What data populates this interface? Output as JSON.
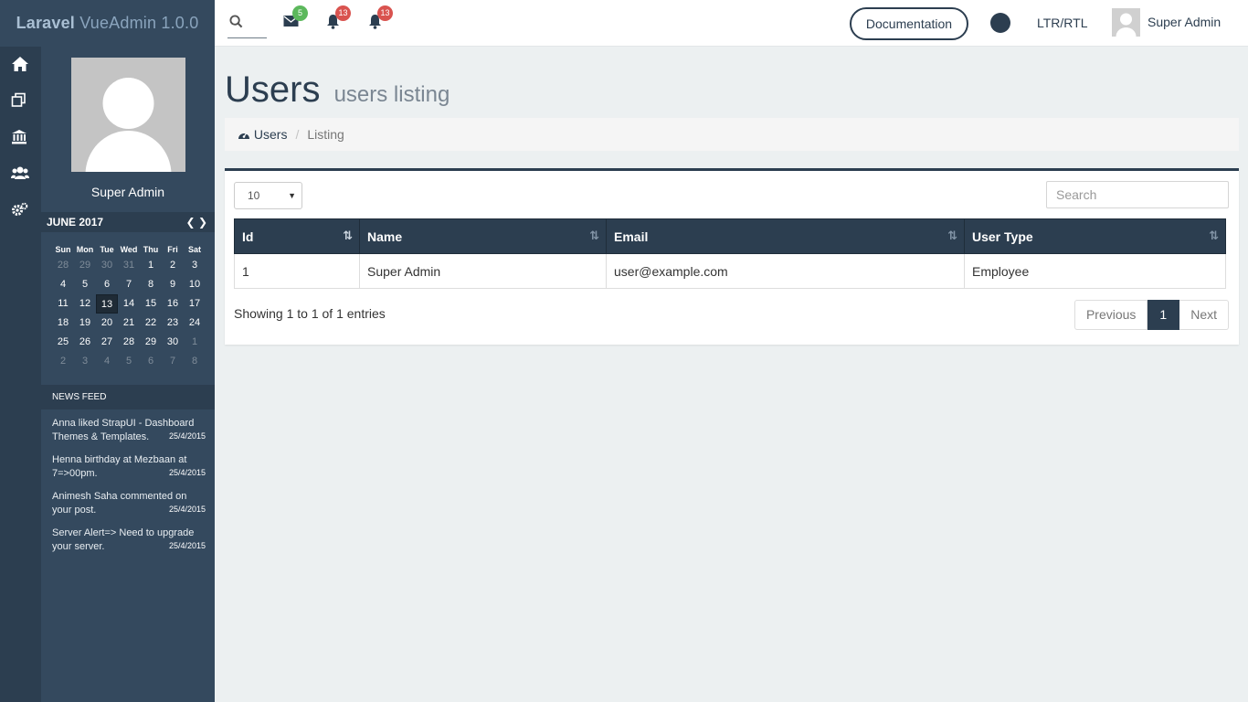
{
  "brand": {
    "bold": "Laravel",
    "rest": " VueAdmin 1.0.0"
  },
  "topbar": {
    "badges": {
      "mail": "5",
      "notifications": "13",
      "alerts": "13"
    },
    "documentation_label": "Documentation",
    "ltr_label": "LTR/RTL",
    "user_name": "Super Admin"
  },
  "sidebar": {
    "user_name": "Super Admin",
    "calendar": {
      "month_label": "JUNE 2017",
      "days_of_week": [
        "Sun",
        "Mon",
        "Tue",
        "Wed",
        "Thu",
        "Fri",
        "Sat"
      ],
      "weeks": [
        [
          "28",
          "29",
          "30",
          "31",
          "1",
          "2",
          "3"
        ],
        [
          "4",
          "5",
          "6",
          "7",
          "8",
          "9",
          "10"
        ],
        [
          "11",
          "12",
          "13",
          "14",
          "15",
          "16",
          "17"
        ],
        [
          "18",
          "19",
          "20",
          "21",
          "22",
          "23",
          "24"
        ],
        [
          "25",
          "26",
          "27",
          "28",
          "29",
          "30",
          "1"
        ],
        [
          "2",
          "3",
          "4",
          "5",
          "6",
          "7",
          "8"
        ]
      ],
      "today": "13"
    },
    "news_feed": {
      "title": "NEWS FEED",
      "items": [
        {
          "text": "Anna liked StrapUI - Dashboard Themes & Templates.",
          "date": "25/4/2015"
        },
        {
          "text": "Henna birthday at Mezbaan at 7=>00pm.",
          "date": "25/4/2015"
        },
        {
          "text": "Animesh Saha commented on your post.",
          "date": "25/4/2015"
        },
        {
          "text": "Server Alert=> Need to upgrade your server.",
          "date": "25/4/2015"
        }
      ]
    }
  },
  "main": {
    "title": "Users",
    "subtitle": "users listing",
    "breadcrumb": {
      "home": "Users",
      "current": "Listing"
    },
    "page_size": "10",
    "search_placeholder": "Search",
    "table": {
      "columns": [
        "Id",
        "Name",
        "Email",
        "User Type"
      ],
      "rows": [
        [
          "1",
          "Super Admin",
          "user@example.com",
          "Employee"
        ]
      ]
    },
    "showing": "Showing 1 to 1 of 1 entries",
    "pagination": {
      "previous": "Previous",
      "current": "1",
      "next": "Next"
    }
  }
}
